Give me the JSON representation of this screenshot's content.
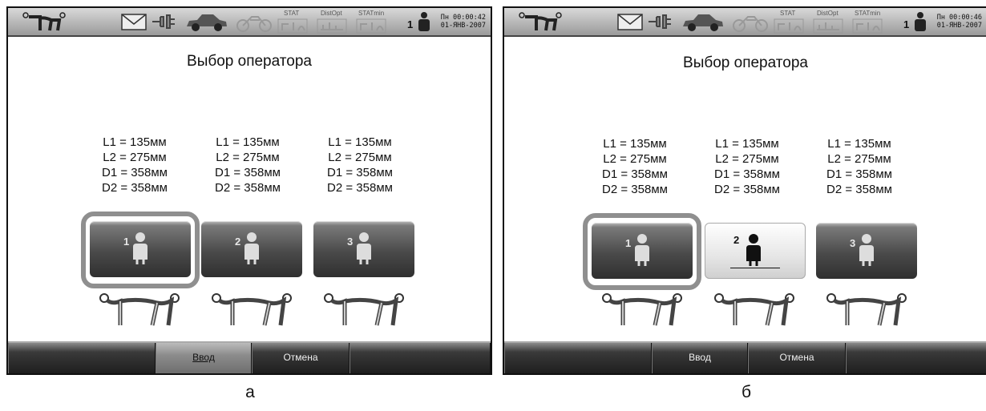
{
  "screens": [
    {
      "id": "a",
      "title": "Выбор оператора",
      "clock": {
        "line1": "Пн 00:00:42",
        "line2": "01-ЯНВ-2007"
      },
      "status_labels": [
        "STAT",
        "DistOpt",
        "STATmin"
      ],
      "current_operator": "1",
      "operators": [
        {
          "num": "1",
          "L1": "L1 = 135мм",
          "L2": "L2 = 275мм",
          "D1": "D1 = 358мм",
          "D2": "D2 = 358мм",
          "state": "selected"
        },
        {
          "num": "2",
          "L1": "L1 = 135мм",
          "L2": "L2 = 275мм",
          "D1": "D1 = 358мм",
          "D2": "D2 = 358мм",
          "state": "normal"
        },
        {
          "num": "3",
          "L1": "L1 = 135мм",
          "L2": "L2 = 275мм",
          "D1": "D1 = 358мм",
          "D2": "D2 = 358мм",
          "state": "normal"
        }
      ],
      "buttons": {
        "enter": "Ввод",
        "cancel": "Отмена"
      },
      "caption": "а"
    },
    {
      "id": "b",
      "title": "Выбор оператора",
      "clock": {
        "line1": "Пн 00:00:46",
        "line2": "01-ЯНВ-2007"
      },
      "status_labels": [
        "STAT",
        "DistOpt",
        "STATmin"
      ],
      "current_operator": "1",
      "operators": [
        {
          "num": "1",
          "L1": "L1 = 135мм",
          "L2": "L2 = 275мм",
          "D1": "D1 = 358мм",
          "D2": "D2 = 358мм",
          "state": "selected"
        },
        {
          "num": "2",
          "L1": "L1 = 135мм",
          "L2": "L2 = 275мм",
          "D1": "D1 = 358мм",
          "D2": "D2 = 358мм",
          "state": "highlighted"
        },
        {
          "num": "3",
          "L1": "L1 = 135мм",
          "L2": "L2 = 275мм",
          "D1": "D1 = 358мм",
          "D2": "D2 = 358мм",
          "state": "normal"
        }
      ],
      "buttons": {
        "enter": "Ввод",
        "cancel": "Отмена"
      },
      "caption": "б"
    }
  ]
}
